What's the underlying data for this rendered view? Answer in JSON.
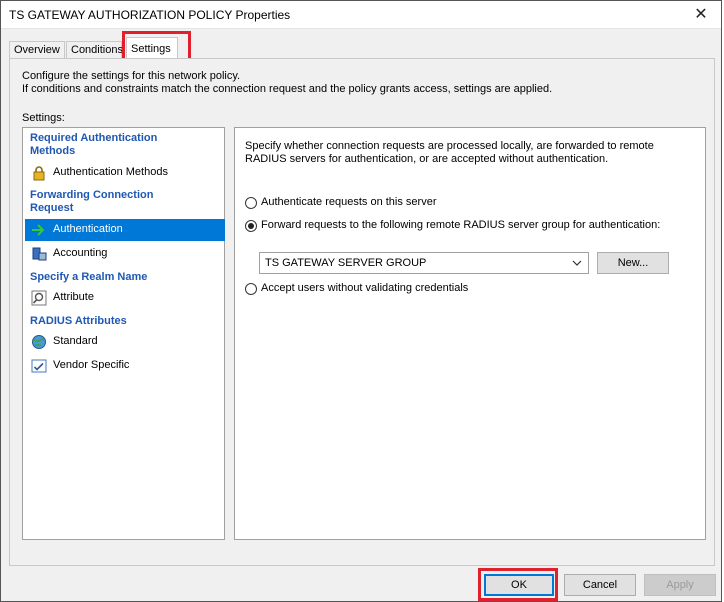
{
  "window": {
    "title": "TS GATEWAY AUTHORIZATION POLICY Properties",
    "close_glyph": "✕"
  },
  "tabs": [
    {
      "label": "Overview"
    },
    {
      "label": "Conditions"
    },
    {
      "label": "Settings"
    }
  ],
  "description_line1": "Configure the settings for this network policy.",
  "description_line2": "If conditions and constraints match the connection request and the policy grants access, settings are applied.",
  "settings_label": "Settings:",
  "nav": {
    "group1": "Required Authentication Methods",
    "item_auth_methods": "Authentication Methods",
    "group2": "Forwarding Connection Request",
    "item_authentication": "Authentication",
    "item_accounting": "Accounting",
    "group3": "Specify a Realm Name",
    "item_attribute": "Attribute",
    "group4": "RADIUS Attributes",
    "item_standard": "Standard",
    "item_vendor": "Vendor Specific"
  },
  "panel": {
    "description": "Specify whether connection requests are processed locally, are forwarded to remote RADIUS servers for authentication, or are accepted without authentication.",
    "radio_local": "Authenticate requests on this server",
    "radio_forward": "Forward requests to the following remote RADIUS server group for authentication:",
    "server_group": "TS GATEWAY SERVER GROUP",
    "new_button": "New...",
    "radio_accept": "Accept users without validating credentials",
    "selected_option": "radio_forward"
  },
  "buttons": {
    "ok": "OK",
    "cancel": "Cancel",
    "apply": "Apply"
  },
  "colors": {
    "highlight": "#e0202c",
    "selection": "#0078d7",
    "group_heading": "#1f58b2"
  }
}
